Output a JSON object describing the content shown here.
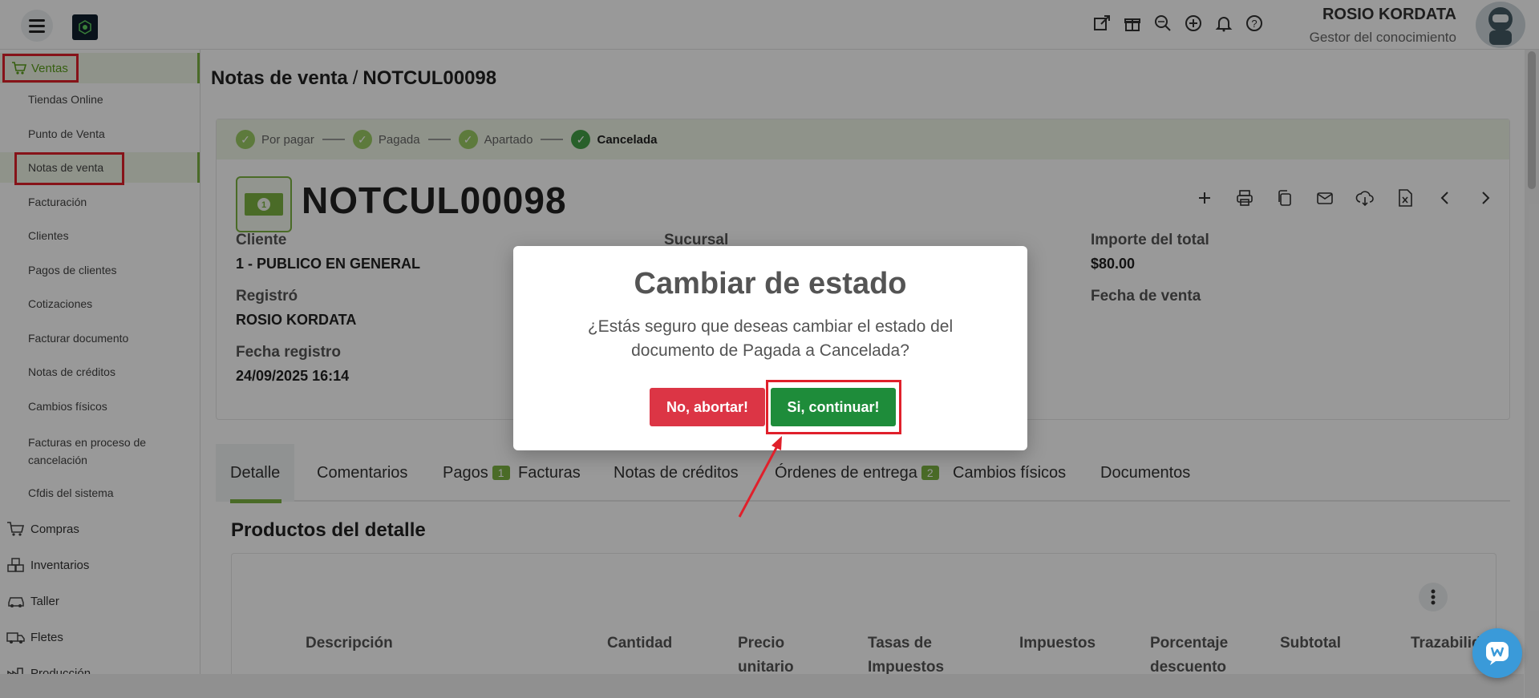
{
  "user": {
    "name": "ROSIO KORDATA",
    "role": "Gestor del conocimiento"
  },
  "sidebar": {
    "ventas_label": "Ventas",
    "items": [
      {
        "label": "Tiendas Online"
      },
      {
        "label": "Punto de Venta"
      },
      {
        "label": "Notas de venta"
      },
      {
        "label": "Facturación"
      },
      {
        "label": "Clientes"
      },
      {
        "label": "Pagos de clientes"
      },
      {
        "label": "Cotizaciones"
      },
      {
        "label": "Facturar documento"
      },
      {
        "label": "Notas de créditos"
      },
      {
        "label": "Cambios físicos"
      },
      {
        "label": "Facturas en proceso de cancelación"
      },
      {
        "label": "Cfdis del sistema"
      }
    ],
    "groups": [
      {
        "label": "Compras"
      },
      {
        "label": "Inventarios"
      },
      {
        "label": "Taller"
      },
      {
        "label": "Fletes"
      },
      {
        "label": "Producción"
      }
    ]
  },
  "breadcrumb": {
    "parent": "Notas de venta",
    "sep": "/",
    "current": "NOTCUL00098"
  },
  "steps": [
    {
      "label": "Por pagar"
    },
    {
      "label": "Pagada"
    },
    {
      "label": "Apartado"
    },
    {
      "label": "Cancelada"
    }
  ],
  "document": {
    "title": "NOTCUL00098",
    "cliente_label": "Cliente",
    "cliente_value": "1 - PUBLICO EN GENERAL",
    "sucursal_label": "Sucursal",
    "importe_label": "Importe del total",
    "importe_value": "$80.00",
    "registro_label": "Registró",
    "registro_value": "ROSIO KORDATA",
    "fecha_venta_label": "Fecha de venta",
    "fecha_registro_label": "Fecha registro",
    "fecha_registro_value": "24/09/2025 16:14"
  },
  "tabs": [
    {
      "label": "Detalle"
    },
    {
      "label": "Comentarios"
    },
    {
      "label": "Pagos",
      "badge": "1"
    },
    {
      "label": "Facturas"
    },
    {
      "label": "Notas de créditos"
    },
    {
      "label": "Órdenes de entrega",
      "badge": "2"
    },
    {
      "label": "Cambios físicos"
    },
    {
      "label": "Documentos"
    }
  ],
  "products": {
    "title": "Productos del detalle",
    "columns": [
      "Descripción",
      "Cantidad",
      "Precio unitario",
      "Tasas de Impuestos",
      "Impuestos",
      "Porcentaje descuento",
      "Subtotal",
      "Trazabilid"
    ]
  },
  "modal": {
    "title": "Cambiar de estado",
    "text": "¿Estás seguro que deseas cambiar el estado del documento de Pagada a Cancelada?",
    "cancel_label": "No, abortar!",
    "confirm_label": "Si, continuar!"
  },
  "colors": {
    "accent": "#7cb342",
    "danger": "#dc3545",
    "success": "#1e8c3a",
    "highlight": "#e0202b"
  }
}
